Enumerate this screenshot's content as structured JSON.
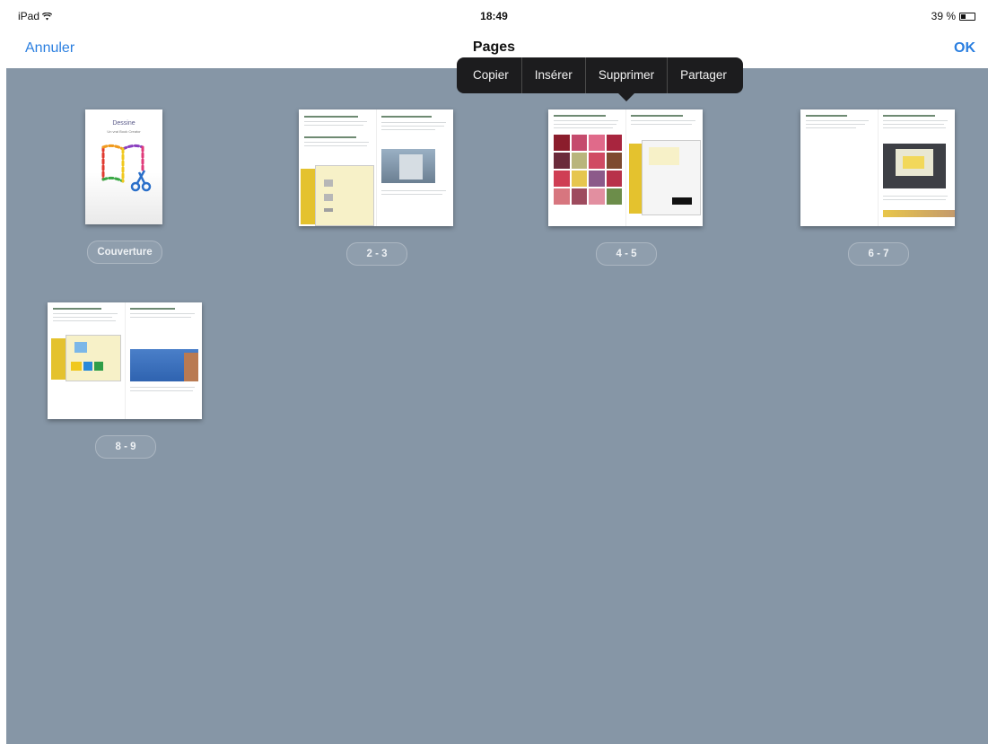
{
  "status": {
    "device": "iPad",
    "time": "18:49",
    "battery": "39 %",
    "battery_level": 0.39
  },
  "nav": {
    "cancel": "Annuler",
    "title": "Pages",
    "done": "OK"
  },
  "menu": [
    "Copier",
    "Insérer",
    "Supprimer",
    "Partager"
  ],
  "cover": {
    "title": "Dessine",
    "subtitle": "Un vrai Book Creator"
  },
  "pages": [
    {
      "label": "Couverture"
    },
    {
      "label": "2 - 3"
    },
    {
      "label": "4 - 5"
    },
    {
      "label": "6 - 7"
    },
    {
      "label": "8 - 9"
    }
  ],
  "colors": {
    "background": "#8696a6",
    "accent": "#2b7fe0",
    "popover": "#1c1c1e",
    "page_yellow": "#e4c22e"
  }
}
